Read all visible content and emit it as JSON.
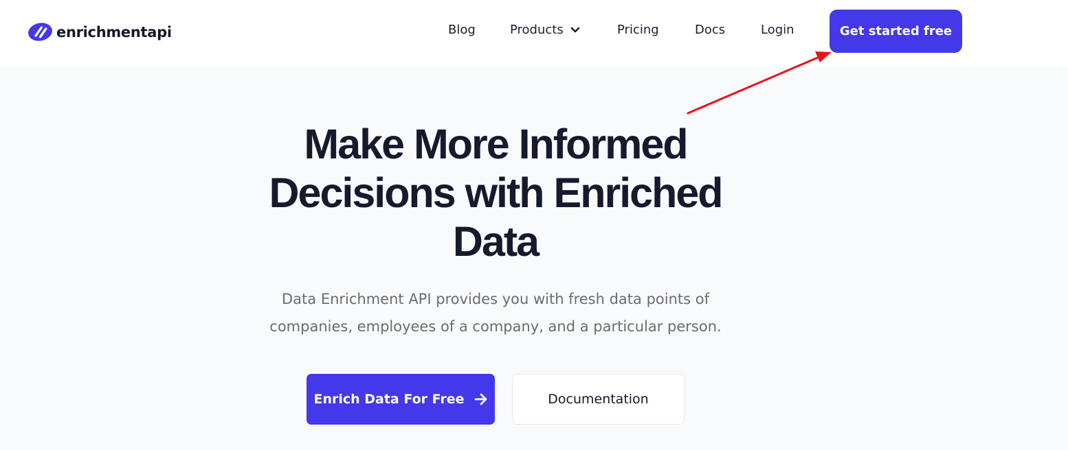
{
  "brand": {
    "name": "enrichmentapi",
    "accent": "#4338ea"
  },
  "nav": {
    "blog": "Blog",
    "products": "Products",
    "pricing": "Pricing",
    "docs": "Docs",
    "login": "Login",
    "cta": "Get started free"
  },
  "hero": {
    "headline_line1": "Make More Informed",
    "headline_line2": "Decisions with Enriched",
    "headline_line3": "Data",
    "sub_line1": "Data Enrichment API provides you with fresh data points of",
    "sub_line2": "companies, employees of a company, and a particular person.",
    "primary_button": "Enrich Data For Free",
    "secondary_button": "Documentation"
  },
  "annotation": {
    "color": "#e8141b",
    "points_to": "Get started free"
  }
}
